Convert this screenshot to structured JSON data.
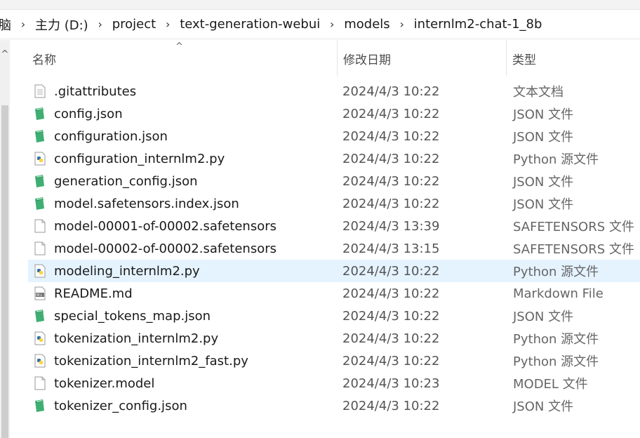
{
  "breadcrumb": [
    {
      "label": "脑"
    },
    {
      "label": "主力 (D:)"
    },
    {
      "label": "project"
    },
    {
      "label": "text-generation-webui"
    },
    {
      "label": "models"
    },
    {
      "label": "internlm2-chat-1_8b"
    }
  ],
  "columns": {
    "name": "名称",
    "date": "修改日期",
    "type": "类型"
  },
  "files": [
    {
      "name": ".gitattributes",
      "date": "2024/4/3 10:22",
      "type": "文本文档",
      "icon": "text-file-icon"
    },
    {
      "name": "config.json",
      "date": "2024/4/3 10:22",
      "type": "JSON 文件",
      "icon": "json-file-icon"
    },
    {
      "name": "configuration.json",
      "date": "2024/4/3 10:22",
      "type": "JSON 文件",
      "icon": "json-file-icon"
    },
    {
      "name": "configuration_internlm2.py",
      "date": "2024/4/3 10:22",
      "type": "Python 源文件",
      "icon": "python-file-icon"
    },
    {
      "name": "generation_config.json",
      "date": "2024/4/3 10:22",
      "type": "JSON 文件",
      "icon": "json-file-icon"
    },
    {
      "name": "model.safetensors.index.json",
      "date": "2024/4/3 10:22",
      "type": "JSON 文件",
      "icon": "json-file-icon"
    },
    {
      "name": "model-00001-of-00002.safetensors",
      "date": "2024/4/3 13:39",
      "type": "SAFETENSORS 文件",
      "icon": "blank-file-icon"
    },
    {
      "name": "model-00002-of-00002.safetensors",
      "date": "2024/4/3 13:15",
      "type": "SAFETENSORS 文件",
      "icon": "blank-file-icon"
    },
    {
      "name": "modeling_internlm2.py",
      "date": "2024/4/3 10:22",
      "type": "Python 源文件",
      "icon": "python-file-icon"
    },
    {
      "name": "README.md",
      "date": "2024/4/3 10:22",
      "type": "Markdown File",
      "icon": "markdown-file-icon"
    },
    {
      "name": "special_tokens_map.json",
      "date": "2024/4/3 10:22",
      "type": "JSON 文件",
      "icon": "json-file-icon"
    },
    {
      "name": "tokenization_internlm2.py",
      "date": "2024/4/3 10:22",
      "type": "Python 源文件",
      "icon": "python-file-icon"
    },
    {
      "name": "tokenization_internlm2_fast.py",
      "date": "2024/4/3 10:22",
      "type": "Python 源文件",
      "icon": "python-file-icon"
    },
    {
      "name": "tokenizer.model",
      "date": "2024/4/3 10:23",
      "type": "MODEL 文件",
      "icon": "blank-file-icon"
    },
    {
      "name": "tokenizer_config.json",
      "date": "2024/4/3 10:22",
      "type": "JSON 文件",
      "icon": "json-file-icon"
    }
  ],
  "selected_file": "modeling_internlm2.py",
  "colors": {
    "selection": "#e5f3ff",
    "json_icon": "#3fae72",
    "python_blue": "#3572a5",
    "python_yellow": "#ffd43b"
  }
}
